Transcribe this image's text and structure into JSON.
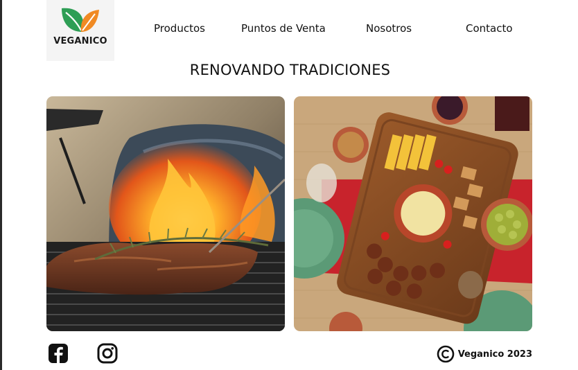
{
  "header": {
    "logo_text": "VEGANICO",
    "nav": {
      "productos": "Productos",
      "puntos_de_venta": "Puntos de Venta",
      "nosotros": "Nosotros",
      "contacto": "Contacto"
    }
  },
  "main": {
    "title": "RENOVANDO TRADICIONES",
    "images": [
      {
        "name": "grilled-meat-photo"
      },
      {
        "name": "appetizer-platter-photo"
      }
    ]
  },
  "footer": {
    "social": [
      "facebook-icon",
      "instagram-icon"
    ],
    "copyright_text": "Veganico 2023"
  },
  "colors": {
    "leaf_green": "#2e9e55",
    "leaf_orange": "#f08a24",
    "text": "#111111"
  }
}
